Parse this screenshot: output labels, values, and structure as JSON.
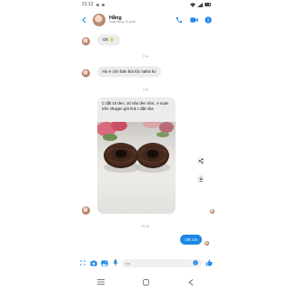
{
  "status_bar": {
    "time": "21:12",
    "battery_level": 0.8
  },
  "header": {
    "contact_name": "Hằng",
    "contact_status": "Hoạt động 14 phút",
    "icons": [
      "back-arrow-icon",
      "phone-icon",
      "video-icon",
      "info-icon"
    ],
    "accent_color": "#1e88e5"
  },
  "messages": [
    {
      "from": "contact",
      "text": "Oh 👌"
    },
    {
      "type": "time",
      "text": "7:14"
    },
    {
      "from": "contact",
      "text": "Alo e còn bán búi tóc natra ko"
    },
    {
      "type": "time",
      "text": "7:57"
    },
    {
      "from": "contact",
      "text": "C đặt 10 đen, 10 nâu đen nha , e soạn trên shoppe gửi link c đặt nha"
    },
    {
      "type": "time",
      "text": "21:10"
    },
    {
      "from": "me",
      "text": "OK c/v"
    }
  ],
  "composer": {
    "placeholder": "Aa",
    "icons": [
      "menu-icon",
      "camera-icon",
      "image-icon",
      "mic-icon",
      "emoji-icon",
      "like-icon"
    ]
  }
}
